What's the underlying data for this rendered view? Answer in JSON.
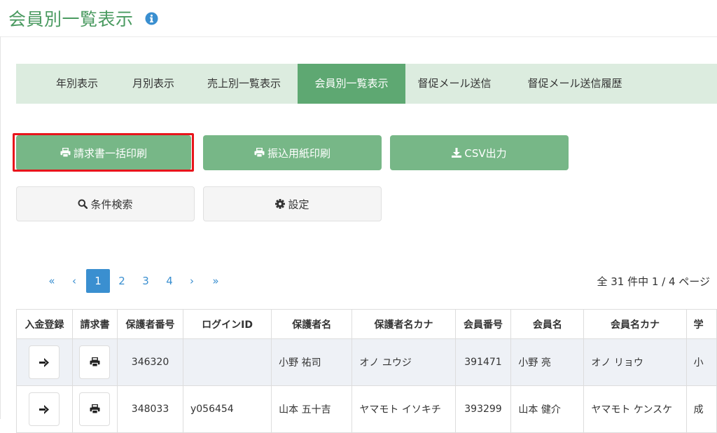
{
  "header": {
    "title": "会員別一覧表示",
    "info_icon": "info-circle-icon",
    "color": "#4a9a60"
  },
  "tabs": [
    {
      "label": "年別表示",
      "active": false
    },
    {
      "label": "月別表示",
      "active": false
    },
    {
      "label": "売上別一覧表示",
      "active": false
    },
    {
      "label": "会員別一覧表示",
      "active": true
    },
    {
      "label": "督促メール送信",
      "active": false
    },
    {
      "label": "督促メール送信履歴",
      "active": false
    }
  ],
  "actions": {
    "bulk_print": "請求書一括印刷",
    "transfer_print": "振込用紙印刷",
    "csv": "CSV出力",
    "search": "条件検索",
    "settings": "設定"
  },
  "pagination": {
    "first": "«",
    "prev": "‹",
    "pages": [
      "1",
      "2",
      "3",
      "4"
    ],
    "current": "1",
    "next": "›",
    "last": "»",
    "summary": "全 31 件中 1 / 4 ページ"
  },
  "table": {
    "headers": [
      "入金登録",
      "請求書",
      "保護者番号",
      "ログインID",
      "保護者名",
      "保護者名カナ",
      "会員番号",
      "会員名",
      "会員名カナ",
      "学"
    ],
    "rows": [
      {
        "guardian_no": "346320",
        "login_id": "",
        "guardian_name": "小野 祐司",
        "guardian_kana": "オノ ユウジ",
        "member_no": "391471",
        "member_name": "小野 亮",
        "member_kana": "オノ リョウ",
        "extra": "小"
      },
      {
        "guardian_no": "348033",
        "login_id": "y056454",
        "guardian_name": "山本 五十吉",
        "guardian_kana": "ヤマモト イソキチ",
        "member_no": "393299",
        "member_name": "山本 健介",
        "member_kana": "ヤマモト ケンスケ",
        "extra": "成"
      }
    ]
  },
  "colors": {
    "tab_bg": "#dcecdf",
    "tab_active": "#5ea872",
    "button_green": "#77b787",
    "highlight": "#e8141b",
    "link": "#3a8fd0"
  }
}
